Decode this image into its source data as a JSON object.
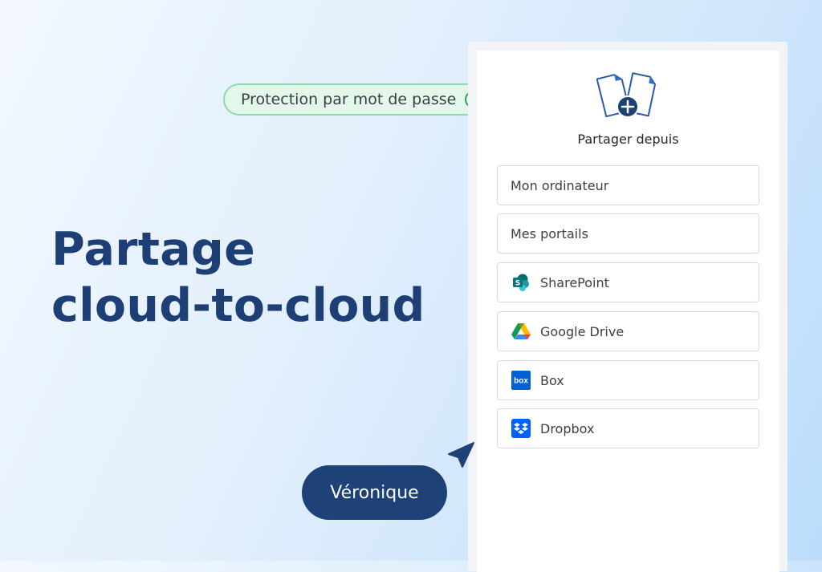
{
  "headline": {
    "line1": "Partage",
    "line2": "cloud-to-cloud"
  },
  "badge": {
    "label": "Protection par mot de passe",
    "icon": "check-circle-icon",
    "color": "#2e9e5b"
  },
  "panel": {
    "title": "Partager depuis",
    "icon": "share-files-plus-icon",
    "options": [
      {
        "label": "Mon ordinateur",
        "icon": null
      },
      {
        "label": "Mes portails",
        "icon": null
      },
      {
        "label": "SharePoint",
        "icon": "sharepoint-icon"
      },
      {
        "label": "Google Drive",
        "icon": "google-drive-icon"
      },
      {
        "label": "Box",
        "icon": "box-icon",
        "icon_text": "box"
      },
      {
        "label": "Dropbox",
        "icon": "dropbox-icon"
      }
    ]
  },
  "user_pill": {
    "name": "Véronique",
    "color": "#1e4178"
  },
  "colors": {
    "accent": "#1e3f75",
    "badge_bg": "#e3f7ea",
    "badge_border": "#8fd9ac"
  }
}
